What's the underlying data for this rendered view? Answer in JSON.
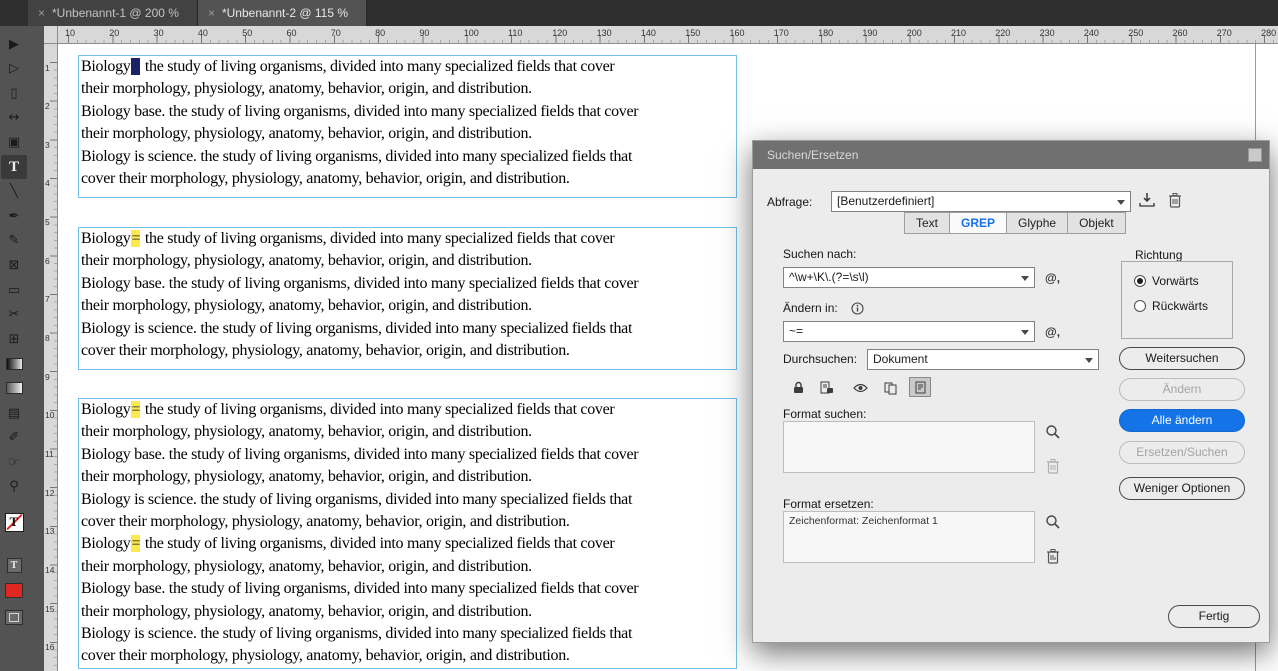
{
  "window": {
    "close_glyph": "×",
    "tabs": [
      {
        "label": "*Unbenannt-1 @ 200 %",
        "active": false
      },
      {
        "label": "*Unbenannt-2 @ 115 %",
        "active": true
      }
    ]
  },
  "rulers": {
    "horizontal_numbers": [
      10,
      20,
      30,
      40,
      50,
      60,
      70,
      80,
      90,
      100,
      110,
      120,
      130,
      140,
      150,
      160,
      170,
      180,
      190,
      200,
      210,
      220,
      230,
      240,
      250,
      260,
      270,
      280
    ],
    "vertical_numbers": [
      1,
      2,
      3,
      4,
      5,
      6,
      7,
      8,
      9,
      10,
      11,
      12,
      13,
      14,
      15,
      16
    ]
  },
  "toolbar": {
    "text_proxy_glyph": "T",
    "tools": [
      {
        "name": "selection-tool",
        "glyph": "▶"
      },
      {
        "name": "direct-selection-tool",
        "glyph": "▷"
      },
      {
        "name": "page-tool",
        "glyph": "▯"
      },
      {
        "name": "gap-tool",
        "glyph": "↔"
      },
      {
        "name": "content-collector-tool",
        "glyph": "▣"
      },
      {
        "name": "type-tool",
        "glyph": "T",
        "active": true
      },
      {
        "name": "line-tool",
        "glyph": "╲"
      },
      {
        "name": "pen-tool",
        "glyph": "✒"
      },
      {
        "name": "pencil-tool",
        "glyph": "✎"
      },
      {
        "name": "rectangle-frame-tool",
        "glyph": "⊠"
      },
      {
        "name": "rectangle-tool",
        "glyph": "▭"
      },
      {
        "name": "scissors-tool",
        "glyph": "✂"
      },
      {
        "name": "free-transform-tool",
        "glyph": "⊞"
      },
      {
        "name": "gradient-tool",
        "glyph": ""
      },
      {
        "name": "gradient-feather-tool",
        "glyph": ""
      },
      {
        "name": "note-tool",
        "glyph": "▤"
      },
      {
        "name": "eyedropper-tool",
        "glyph": "✐"
      },
      {
        "name": "hand-tool",
        "glyph": "☞"
      },
      {
        "name": "zoom-tool",
        "glyph": "⚲"
      }
    ]
  },
  "document": {
    "frames": [
      {
        "lines": [
          [
            "Biology",
            {
              "t": "=",
              "hl": "sel"
            },
            " the study of living organisms, divided into many specialized fields that cover"
          ],
          [
            "their morphology, physiology, anatomy, behavior, origin, and distribution."
          ],
          [
            "Biology base. the study of living organisms, divided into many specialized fields that cover"
          ],
          [
            "their morphology, physiology, anatomy, behavior, origin, and distribution."
          ],
          [
            "Biology is science. the study of living organisms, divided into many specialized fields that"
          ],
          [
            "cover their morphology, physiology, anatomy, behavior, origin, and distribution."
          ]
        ]
      },
      {
        "lines": [
          [
            "Biology",
            {
              "t": "=",
              "hl": "yel"
            },
            " the study of living organisms, divided into many specialized fields that cover"
          ],
          [
            "their morphology, physiology, anatomy, behavior, origin, and distribution."
          ],
          [
            "Biology base. the study of living organisms, divided into many specialized fields that cover"
          ],
          [
            "their morphology, physiology, anatomy, behavior, origin, and distribution."
          ],
          [
            "Biology is science. the study of living organisms, divided into many specialized fields that"
          ],
          [
            "cover their morphology, physiology, anatomy, behavior, origin, and distribution."
          ]
        ]
      },
      {
        "lines": [
          [
            "Biology",
            {
              "t": "=",
              "hl": "yel"
            },
            " the study of living organisms, divided into many specialized fields that cover"
          ],
          [
            "their morphology, physiology, anatomy, behavior, origin, and distribution."
          ],
          [
            "Biology base. the study of living organisms, divided into many specialized fields that cover"
          ],
          [
            "their morphology, physiology, anatomy, behavior, origin, and distribution."
          ],
          [
            "Biology is science. the study of living organisms, divided into many specialized fields that"
          ],
          [
            "cover their morphology, physiology, anatomy, behavior, origin, and distribution."
          ],
          [
            "Biology",
            {
              "t": "=",
              "hl": "yel"
            },
            " the study of living organisms, divided into many specialized fields that cover"
          ],
          [
            "their morphology, physiology, anatomy, behavior, origin, and distribution."
          ],
          [
            "Biology base. the study of living organisms, divided into many specialized fields that cover"
          ],
          [
            "their morphology, physiology, anatomy, behavior, origin, and distribution."
          ],
          [
            "Biology is science. the study of living organisms, divided into many specialized fields that"
          ],
          [
            "cover their morphology, physiology, anatomy, behavior, origin, and distribution."
          ]
        ]
      }
    ]
  },
  "dialog": {
    "title": "Suchen/Ersetzen",
    "query_label": "Abfrage:",
    "query_value": "[Benutzerdefiniert]",
    "tabs": [
      "Text",
      "GREP",
      "Glyphe",
      "Objekt"
    ],
    "active_tab": "GREP",
    "find_label": "Suchen nach:",
    "find_value": "^\\w+\\K\\.(?=\\s\\l)",
    "special_chars_glyph": "@,",
    "change_label": "Ändern in:",
    "change_value": "~=",
    "scope_label": "Durchsuchen:",
    "scope_value": "Dokument",
    "direction_label": "Richtung",
    "direction_options": [
      "Vorwärts",
      "Rückwärts"
    ],
    "direction_selected": "Vorwärts",
    "scope_icons": [
      {
        "name": "include-locked-layers-icon",
        "pressed": false
      },
      {
        "name": "include-locked-stories-icon",
        "pressed": false
      },
      {
        "name": "include-hidden-layers-icon",
        "pressed": false
      },
      {
        "name": "include-master-pages-icon",
        "pressed": false
      },
      {
        "name": "include-footnotes-icon",
        "pressed": true
      }
    ],
    "buttons": {
      "find_next": "Weitersuchen",
      "change": "Ändern",
      "change_all": "Alle ändern",
      "change_find": "Ersetzen/Suchen",
      "fewer_options": "Weniger Optionen",
      "done": "Fertig"
    },
    "find_format_label": "Format suchen:",
    "change_format_label": "Format ersetzen:",
    "change_format_value": "Zeichenformat: Zeichenformat 1"
  },
  "colors": {
    "accent_blue": "#1473e6",
    "swatch_red": "#e02720",
    "highlight_yellow": "#fce94f",
    "selection_navy": "#1c2268",
    "frame_blue": "#74bfe8",
    "guide_violet": "#b184e0"
  }
}
